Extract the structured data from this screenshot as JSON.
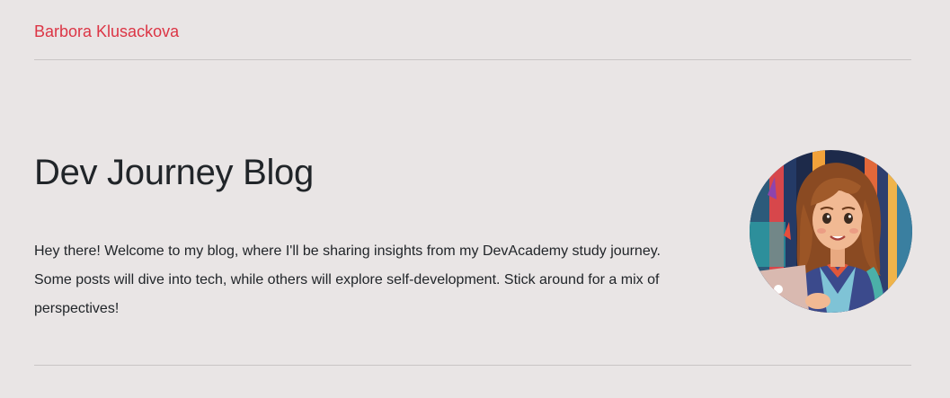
{
  "header": {
    "brand": "Barbora Klusackova"
  },
  "hero": {
    "title": "Dev Journey Blog",
    "intro": "Hey there! Welcome to my blog, where I'll be sharing insights from my DevAcademy study journey. Some posts will dive into tech, while others will explore self-development. Stick around for a mix of perspectives!",
    "avatar_icon": "avatar-illustration"
  },
  "colors": {
    "background": "#e9e5e5",
    "brand_link": "#dc3545",
    "text": "#212529",
    "divider": "#c9c5c5"
  }
}
